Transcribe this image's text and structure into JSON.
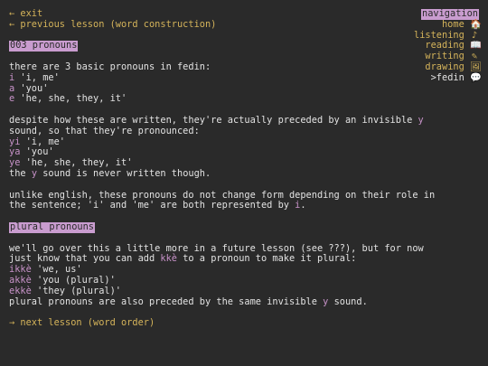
{
  "links": {
    "exit": "← exit",
    "previous": "← previous lesson (word construction)",
    "next": "→ next lesson (word order)"
  },
  "nav": {
    "title": "navigation",
    "items": [
      {
        "label": "home",
        "icon": "🏠"
      },
      {
        "label": "listening",
        "icon": "♪"
      },
      {
        "label": "reading",
        "icon": "📖"
      },
      {
        "label": "writing",
        "icon": "✎"
      },
      {
        "label": "drawing",
        "icon": "🖼"
      },
      {
        "label": ">fedin",
        "icon": "💬"
      }
    ]
  },
  "section1": {
    "heading": "003 pronouns",
    "intro": "there are 3 basic pronouns in fedin:",
    "words": [
      {
        "word": "i",
        "gloss": " 'i, me'"
      },
      {
        "word": "a",
        "gloss": " 'you'"
      },
      {
        "word": "e",
        "gloss": " 'he, she, they, it'"
      }
    ],
    "para2_line1_a": "despite how these are written, they're actually preceded by an invisible ",
    "para2_line1_b": "y",
    "para2_line2": "sound, so that they're pronounced:",
    "words2": [
      {
        "word": "yi",
        "gloss": " 'i, me'"
      },
      {
        "word": "ya",
        "gloss": " 'you'"
      },
      {
        "word": "ye",
        "gloss": " 'he, she, they, it'"
      }
    ],
    "note_a": "the ",
    "note_b": "y",
    "note_c": " sound is never written though.",
    "para3_line1": "unlike english, these pronouns do not change form depending on their role in",
    "para3_line2_a": "the sentence; 'i' and 'me' are both represented by ",
    "para3_line2_b": "i",
    "para3_line2_c": "."
  },
  "section2": {
    "heading": "plural pronouns",
    "line1": "we'll go over this a little more in a future lesson (see ???), but for now",
    "line2_a": "just know that you can add ",
    "line2_b": "kkè",
    "line2_c": " to a pronoun to make it plural:",
    "words": [
      {
        "word": "ikkè",
        "gloss": " 'we, us'"
      },
      {
        "word": "akkè",
        "gloss": " 'you (plural)'"
      },
      {
        "word": "ekkè",
        "gloss": " 'they (plural)'"
      }
    ],
    "last_a": "plural pronouns are also preceded by the same invisible ",
    "last_b": "y",
    "last_c": " sound."
  },
  "colors": {
    "background": "#2a2a2a",
    "text": "#e2e2e2",
    "link": "#d4b35a",
    "accent": "#c792c8",
    "highlight": "#c99ccf"
  }
}
